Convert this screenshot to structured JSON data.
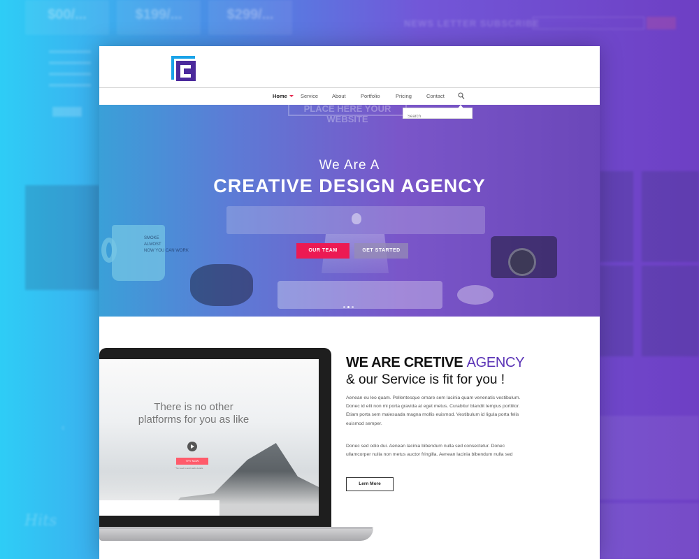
{
  "background": {
    "prices": [
      "$00/...",
      "$199/...",
      "$299/..."
    ],
    "newsletter_title": "NEWS LETTER SUBSCRIBE"
  },
  "colors": {
    "accent": "#ec1a53",
    "brand_purple": "#5b34b6",
    "logo_blue": "#1aa3e8"
  },
  "nav": {
    "items": [
      "Home",
      "Service",
      "About",
      "Portfolio",
      "Pricing",
      "Contact"
    ],
    "active": "Home",
    "search_placeholder": "Search"
  },
  "hero": {
    "sign_text": "PLACE HERE YOUR WEBSITE",
    "mug_text": [
      "SMOKE",
      "ALMOST",
      "NOW YOU CAN WORK"
    ],
    "subtitle": "We  Are A",
    "title": "CREATIVE DESIGN AGENCY",
    "btn_team": "OUR TEAM",
    "btn_start": "GET STARTED"
  },
  "laptop": {
    "screen_line1": "There is no other",
    "screen_line2": "platforms for you as like",
    "try_label": "TRY NOW",
    "try_note": "* No need to add cards details"
  },
  "about": {
    "heading_bold": "WE ARE CRETIVE ",
    "heading_accent": "AGENCY",
    "subheading": "& our Service is fit for you !",
    "para1": "Aenean eu leo quam. Pellentesque ornare sem lacinia quam venenatis vestibulum. Donec id elit non mi porta gravida at eget metus. Curabitur blandit tempus porttitor. Etiam porta sem malesuada magna mollis euismod. Vestibulum id ligula porta felis euismod semper.",
    "para2": "Donec sed odio dui. Aenean lacinia bibendum nulla sed consectetur. Donec ullamcorper nulla non metus auctor fringilla. Aenean lacinia bibendum nulla sed",
    "learn_more": "Lern More"
  }
}
